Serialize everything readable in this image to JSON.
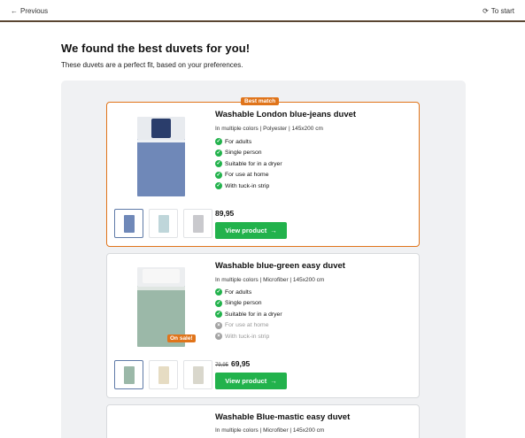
{
  "nav": {
    "previous": "Previous",
    "start": "To start"
  },
  "heading": "We found the best duvets for you!",
  "subheading": "These duvets are a perfect fit, based on your preferences.",
  "products": [
    {
      "badge": "Best match",
      "title": "Washable London blue-jeans duvet",
      "meta": "In multiple colors | Polyester | 145x200 cm",
      "features": [
        {
          "label": "For adults",
          "ok": true
        },
        {
          "label": "Single person",
          "ok": true
        },
        {
          "label": "Suitable for in a dryer",
          "ok": true
        },
        {
          "label": "For use at home",
          "ok": true
        },
        {
          "label": "With tuck-in strip",
          "ok": true
        }
      ],
      "price": "89,95",
      "button": "View product",
      "colors": [
        "#6f88b8",
        "#bfd6da",
        "#c9c9cd"
      ]
    },
    {
      "badge": "On sale!",
      "title": "Washable blue-green easy duvet",
      "meta": "In multiple colors | Microfiber | 145x200 cm",
      "features": [
        {
          "label": "For adults",
          "ok": true
        },
        {
          "label": "Single person",
          "ok": true
        },
        {
          "label": "Suitable for in a dryer",
          "ok": true
        },
        {
          "label": "For use at home",
          "ok": false
        },
        {
          "label": "With tuck-in strip",
          "ok": false
        }
      ],
      "old_price": "79,95",
      "price": "69,95",
      "button": "View product",
      "colors": [
        "#9bb8a8",
        "#e6dcc3",
        "#d9d7cc"
      ]
    },
    {
      "title": "Washable Blue-mastic easy duvet",
      "meta": "In multiple colors | Microfiber | 145x200 cm"
    }
  ],
  "icons": {
    "back": "arrow-left-icon",
    "restart": "refresh-icon",
    "check": "check-circle-icon",
    "cross": "x-circle-icon",
    "arrow": "arrow-right-icon"
  },
  "colors": {
    "accent_orange": "#e0741a",
    "button_green": "#22b24c",
    "panel_gray": "#f0f1f3"
  }
}
